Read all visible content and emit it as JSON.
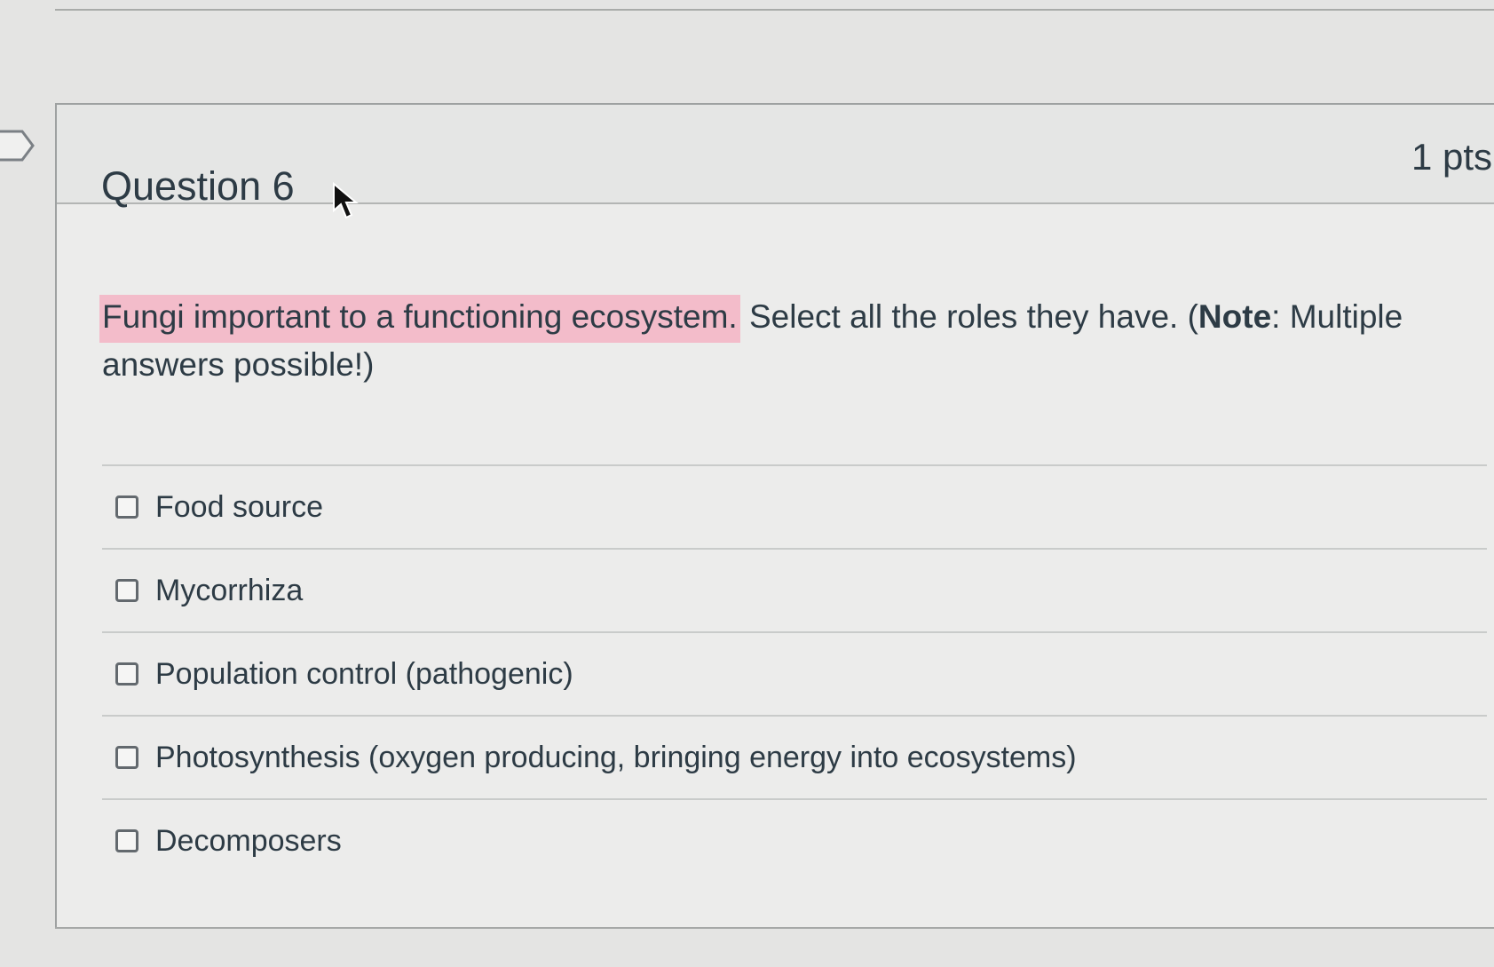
{
  "question": {
    "title": "Question 6",
    "points": "1 pts",
    "text_highlighted": "Fungi important to a functioning ecosystem.",
    "text_before_bold": " Select all the roles they have. (",
    "text_bold": "Note",
    "text_after_bold": ": Multiple answers possible!)"
  },
  "answers": [
    {
      "label": "Food source",
      "checked": false
    },
    {
      "label": "Mycorrhiza",
      "checked": false
    },
    {
      "label": "Population control (pathogenic)",
      "checked": false
    },
    {
      "label": "Photosynthesis (oxygen producing, bringing energy into ecosystems)",
      "checked": false
    },
    {
      "label": "Decomposers",
      "checked": false
    }
  ],
  "colors": {
    "highlight": "#f3bcca",
    "text": "#2d3b45",
    "background": "#e4e4e3"
  },
  "icons": [
    "flag-marker-icon",
    "mouse-cursor-icon",
    "checkbox-icon"
  ]
}
